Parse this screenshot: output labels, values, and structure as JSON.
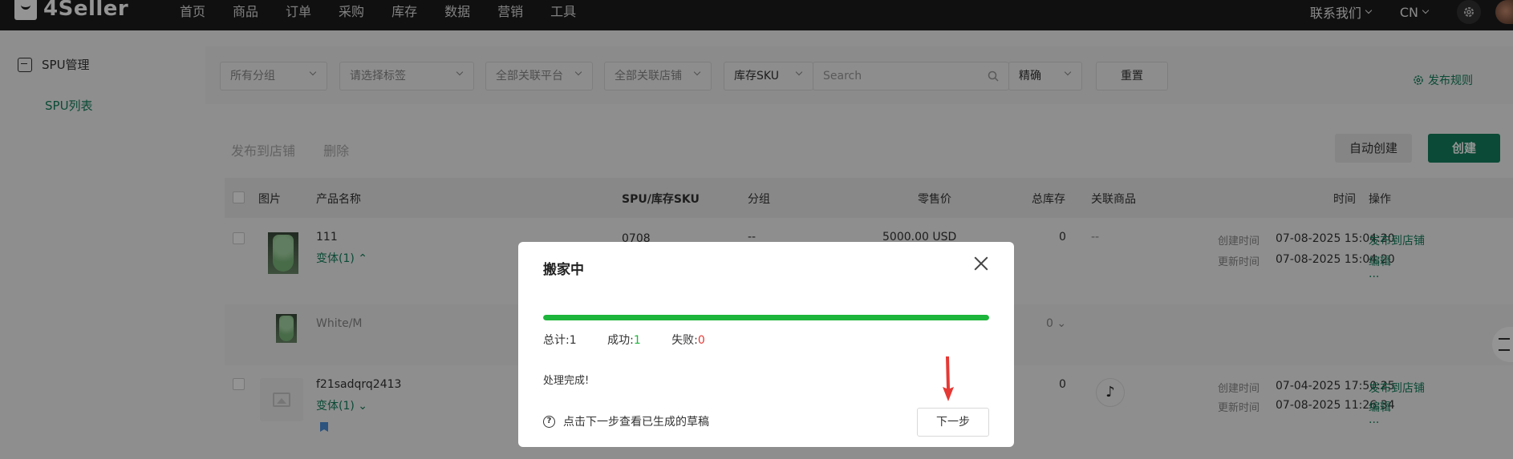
{
  "app": {
    "logo_text": "4Seller"
  },
  "nav": [
    "首页",
    "商品",
    "订单",
    "采购",
    "库存",
    "数据",
    "营销",
    "工具"
  ],
  "topbar": {
    "contact": "联系我们",
    "lang": "CN"
  },
  "sidebar": {
    "section": "SPU管理",
    "item": "SPU列表"
  },
  "filters": {
    "group": "所有分组",
    "tag_placeholder": "请选择标签",
    "platform": "全部关联平台",
    "store": "全部关联店铺",
    "search_field": "库存SKU",
    "search_placeholder": "Search",
    "match_mode": "精确",
    "reset": "重置",
    "publish_rule": "发布规则"
  },
  "toolbar": {
    "publish": "发布到店铺",
    "delete": "删除",
    "auto_create": "自动创建",
    "create": "创建"
  },
  "table": {
    "headers": [
      "图片",
      "产品名称",
      "SPU/库存SKU",
      "分组",
      "零售价",
      "总库存",
      "关联商品",
      "时间",
      "操作"
    ],
    "rows": [
      {
        "name": "111",
        "variants": "变体(1)",
        "sku": "0708",
        "group": "--",
        "price": "5000.00 USD",
        "stock": "0",
        "linked": "--",
        "created_label": "创建时间",
        "created": "07-08-2025 15:04:20",
        "updated_label": "更新时间",
        "updated": "07-08-2025 15:04:20",
        "op1": "发布到店铺",
        "op2": "编辑",
        "op3": "..."
      },
      {
        "name": "White/M",
        "stock": "0"
      },
      {
        "name": "f21sadqrq2413",
        "variants": "变体(1)",
        "stock": "0",
        "created_label": "创建时间",
        "created": "07-04-2025 17:50:25",
        "updated_label": "更新时间",
        "updated": "07-08-2025 11:26:34",
        "op1": "发布到店铺",
        "op2": "编辑",
        "op3": "..."
      }
    ]
  },
  "modal": {
    "title": "搬家中",
    "progress": 1.0,
    "total_label": "总计:",
    "total": "1",
    "success_label": "成功:",
    "success": "1",
    "fail_label": "失败:",
    "fail": "0",
    "status": "处理完成!",
    "hint": "点击下一步查看已生成的草稿",
    "next": "下一步"
  },
  "colors": {
    "brand": "#14805e",
    "progress": "#1db53b",
    "fail": "#e53935",
    "arrow": "#e53935"
  }
}
